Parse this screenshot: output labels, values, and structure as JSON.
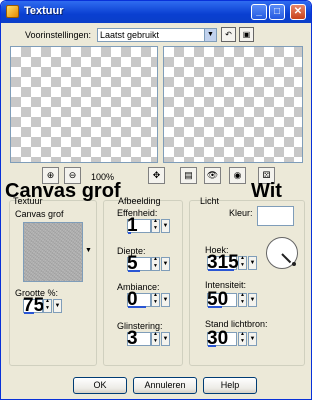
{
  "window": {
    "title": "Textuur",
    "min": "_",
    "max": "□",
    "close": "✕"
  },
  "presets": {
    "label": "Voorinstellingen:",
    "value": "Laatst gebruikt"
  },
  "zoom": {
    "in_icon": "zoom-in",
    "out_icon": "zoom-out",
    "value": "100%"
  },
  "texture": {
    "group_label": "Textuur",
    "overlay_label": "Canvas grof",
    "name": "Canvas grof",
    "size_label": "Grootte %:",
    "size_value": "75"
  },
  "reflection": {
    "group_label": "Afbeelding",
    "flatness_label": "Effenheid:",
    "flatness_value": "1",
    "depth_label": "Diepte:",
    "depth_value": "5",
    "ambience_label": "Ambiance:",
    "ambience_value": "0",
    "shine_label": "Glinstering:",
    "shine_value": "3"
  },
  "light": {
    "group_label": "Licht",
    "color_label": "Kleur:",
    "color_overlay": "Wit",
    "color": "#ffffff",
    "angle_label": "Hoek:",
    "angle_value": "315",
    "intensity_label": "Intensiteit:",
    "intensity_value": "50",
    "elevation_label": "Stand lichtbron:",
    "elevation_value": "30"
  },
  "buttons": {
    "ok": "OK",
    "cancel": "Annuleren",
    "help": "Help"
  }
}
